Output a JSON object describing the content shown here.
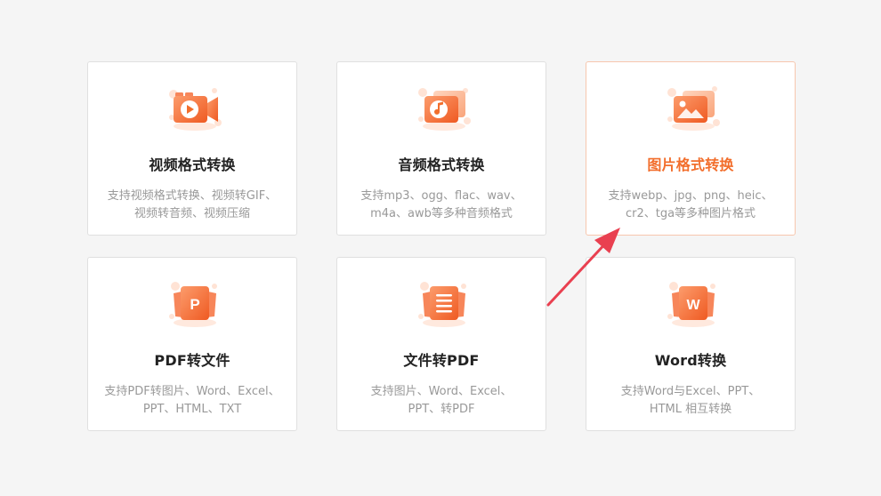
{
  "cards": [
    {
      "title": "视频格式转换",
      "desc": [
        "支持视频格式转换、视频转GIF、",
        "视频转音频、视频压缩"
      ],
      "icon": "video-play-icon"
    },
    {
      "title": "音频格式转换",
      "desc": [
        "支持mp3、ogg、flac、wav、",
        "m4a、awb等多种音频格式"
      ],
      "icon": "music-note-icon"
    },
    {
      "title": "图片格式转换",
      "desc": [
        "支持webp、jpg、png、heic、",
        "cr2、tga等多种图片格式"
      ],
      "icon": "image-icon"
    },
    {
      "title": "PDF转文件",
      "desc": [
        "支持PDF转图片、Word、Excel、",
        "PPT、HTML、TXT"
      ],
      "icon": "ppt-file-icon",
      "icon_letter": "P"
    },
    {
      "title": "文件转PDF",
      "desc": [
        "支持图片、Word、Excel、",
        "PPT、转PDF"
      ],
      "icon": "document-lines-icon"
    },
    {
      "title": "Word转换",
      "desc": [
        "支持Word与Excel、PPT、",
        "HTML 相互转换"
      ],
      "icon": "word-file-icon",
      "icon_letter": "W"
    }
  ],
  "colors": {
    "accent": "#f26e2c",
    "icon_gradient_start": "#fdb08a",
    "icon_gradient_end": "#f05a24",
    "arrow": "#e94050",
    "active_border": "#f7c7ae"
  }
}
